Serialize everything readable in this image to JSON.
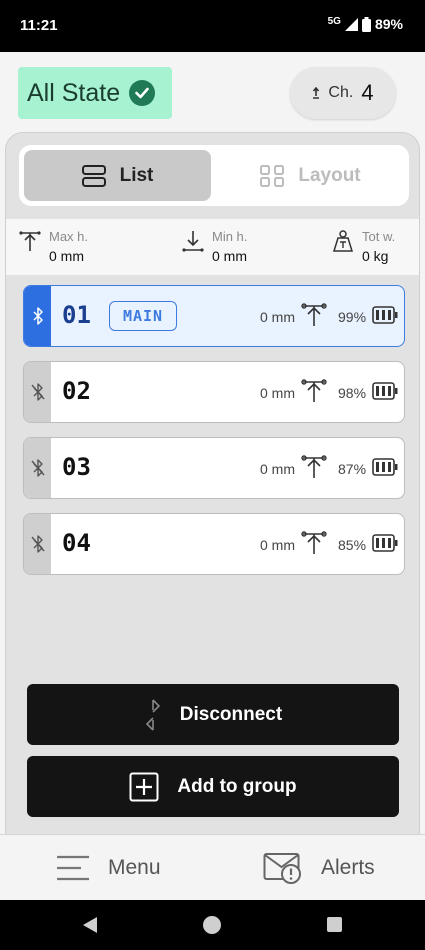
{
  "status_bar": {
    "time": "11:21",
    "network": "5G",
    "battery": "89%"
  },
  "header": {
    "state_label": "All State",
    "channel_label": "Ch.",
    "channel_value": "4"
  },
  "tabs": [
    {
      "label": "List",
      "active": true,
      "icon": "list-icon"
    },
    {
      "label": "Layout",
      "active": false,
      "icon": "grid-icon"
    }
  ],
  "stats": [
    {
      "label": "Max h.",
      "value": "0 mm",
      "icon": "max-height-icon"
    },
    {
      "label": "Min h.",
      "value": "0 mm",
      "icon": "min-height-icon"
    },
    {
      "label": "Tot w.",
      "value": "0 kg",
      "icon": "weight-icon"
    }
  ],
  "devices": [
    {
      "number": "01",
      "tag": "MAIN",
      "height": "0 mm",
      "battery": "99%",
      "battery_level": 0.99,
      "connected": true
    },
    {
      "number": "02",
      "tag": "",
      "height": "0 mm",
      "battery": "98%",
      "battery_level": 0.98,
      "connected": false
    },
    {
      "number": "03",
      "tag": "",
      "height": "0 mm",
      "battery": "87%",
      "battery_level": 0.87,
      "connected": false
    },
    {
      "number": "04",
      "tag": "",
      "height": "0 mm",
      "battery": "85%",
      "battery_level": 0.85,
      "connected": false
    }
  ],
  "actions": {
    "disconnect_label": "Disconnect",
    "add_group_label": "Add to group"
  },
  "bottom_nav": {
    "menu_label": "Menu",
    "alerts_label": "Alerts"
  },
  "colors": {
    "active_blue": "#2d6fe0",
    "state_green": "#a6f2d1",
    "check_green": "#1f7a55",
    "button_dark": "#141414"
  }
}
